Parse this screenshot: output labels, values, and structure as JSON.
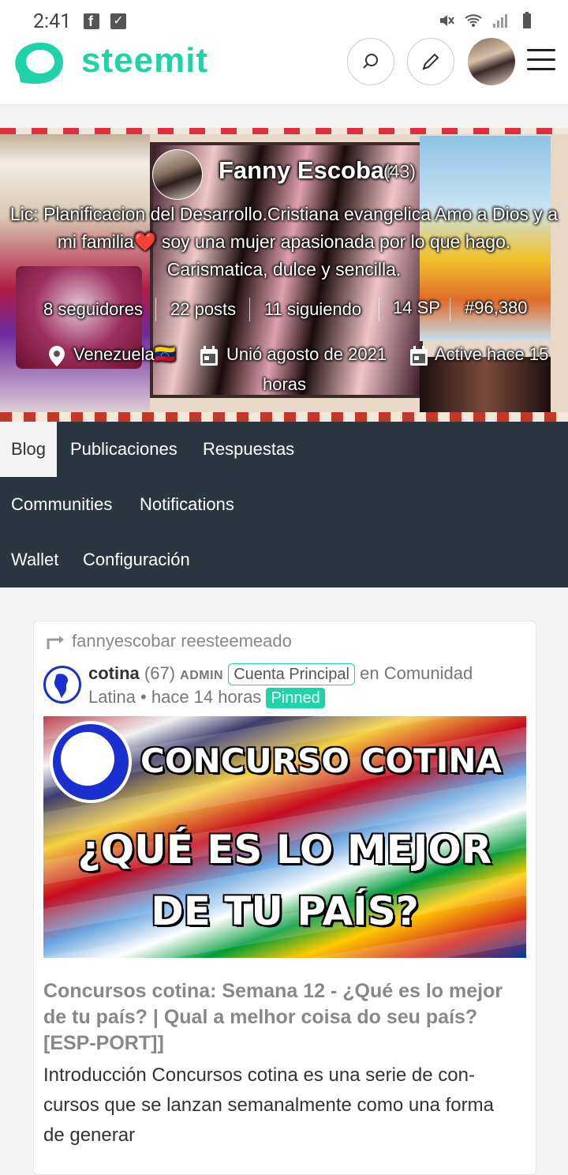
{
  "status_bar": {
    "time": "2:41",
    "fb_letter": "f",
    "check": "✓"
  },
  "header": {
    "brand": "steemit",
    "icons": [
      "search-icon",
      "pencil-icon",
      "avatar",
      "hamburger-icon"
    ]
  },
  "profile": {
    "name": "Fanny Escobar",
    "reputation": "(43)",
    "about": "Lic: Planificacion del Desarrollo.Cristiana evangelica Amo a Dios y a mi familia❤️ soy una mujer apasionada por lo que hago. Carismatica, dulce y sencilla.",
    "stats": {
      "followers": "8 seguidores",
      "posts": "22 posts",
      "following": "11 siguiendo",
      "sp": "14 SP",
      "rank": "#96,380"
    },
    "location": "Venezuela🇻🇪",
    "joined": "Unió agosto de 2021",
    "active_line1": "Active hace 15",
    "active_line2": "horas"
  },
  "tabs": {
    "blog": "Blog",
    "posts": "Publicaciones",
    "replies": "Respuestas",
    "communities": "Communities",
    "notifications": "Notifications",
    "wallet": "Wallet",
    "settings": "Configuración"
  },
  "post": {
    "resteem": "fannyescobar reesteemeado",
    "author": "cotina",
    "author_rep": "(67)",
    "role": "ADMIN",
    "role_title": "Cuenta Principal",
    "community_prefix": "en Comunidad",
    "community_line2": "Latina • hace 14 horas",
    "pinned": "Pinned",
    "image_text": {
      "line1": "CONCURSO COTINA",
      "line2": "¿QUÉ ES LO MEJOR",
      "line3": "DE TU PAÍS?"
    },
    "title": "Concursos cotina: Semana 12 - ¿Qué es lo mejor de tu país? | Qual a melhor coisa do seu país? [ESP-PORT]]",
    "body": "Introducción Concursos cotina es una serie de con-cursos que se lanzan semanalmente como una forma de generar"
  },
  "colors": {
    "brand": "#1fd3a8",
    "tabs_bg": "#2c3641"
  }
}
